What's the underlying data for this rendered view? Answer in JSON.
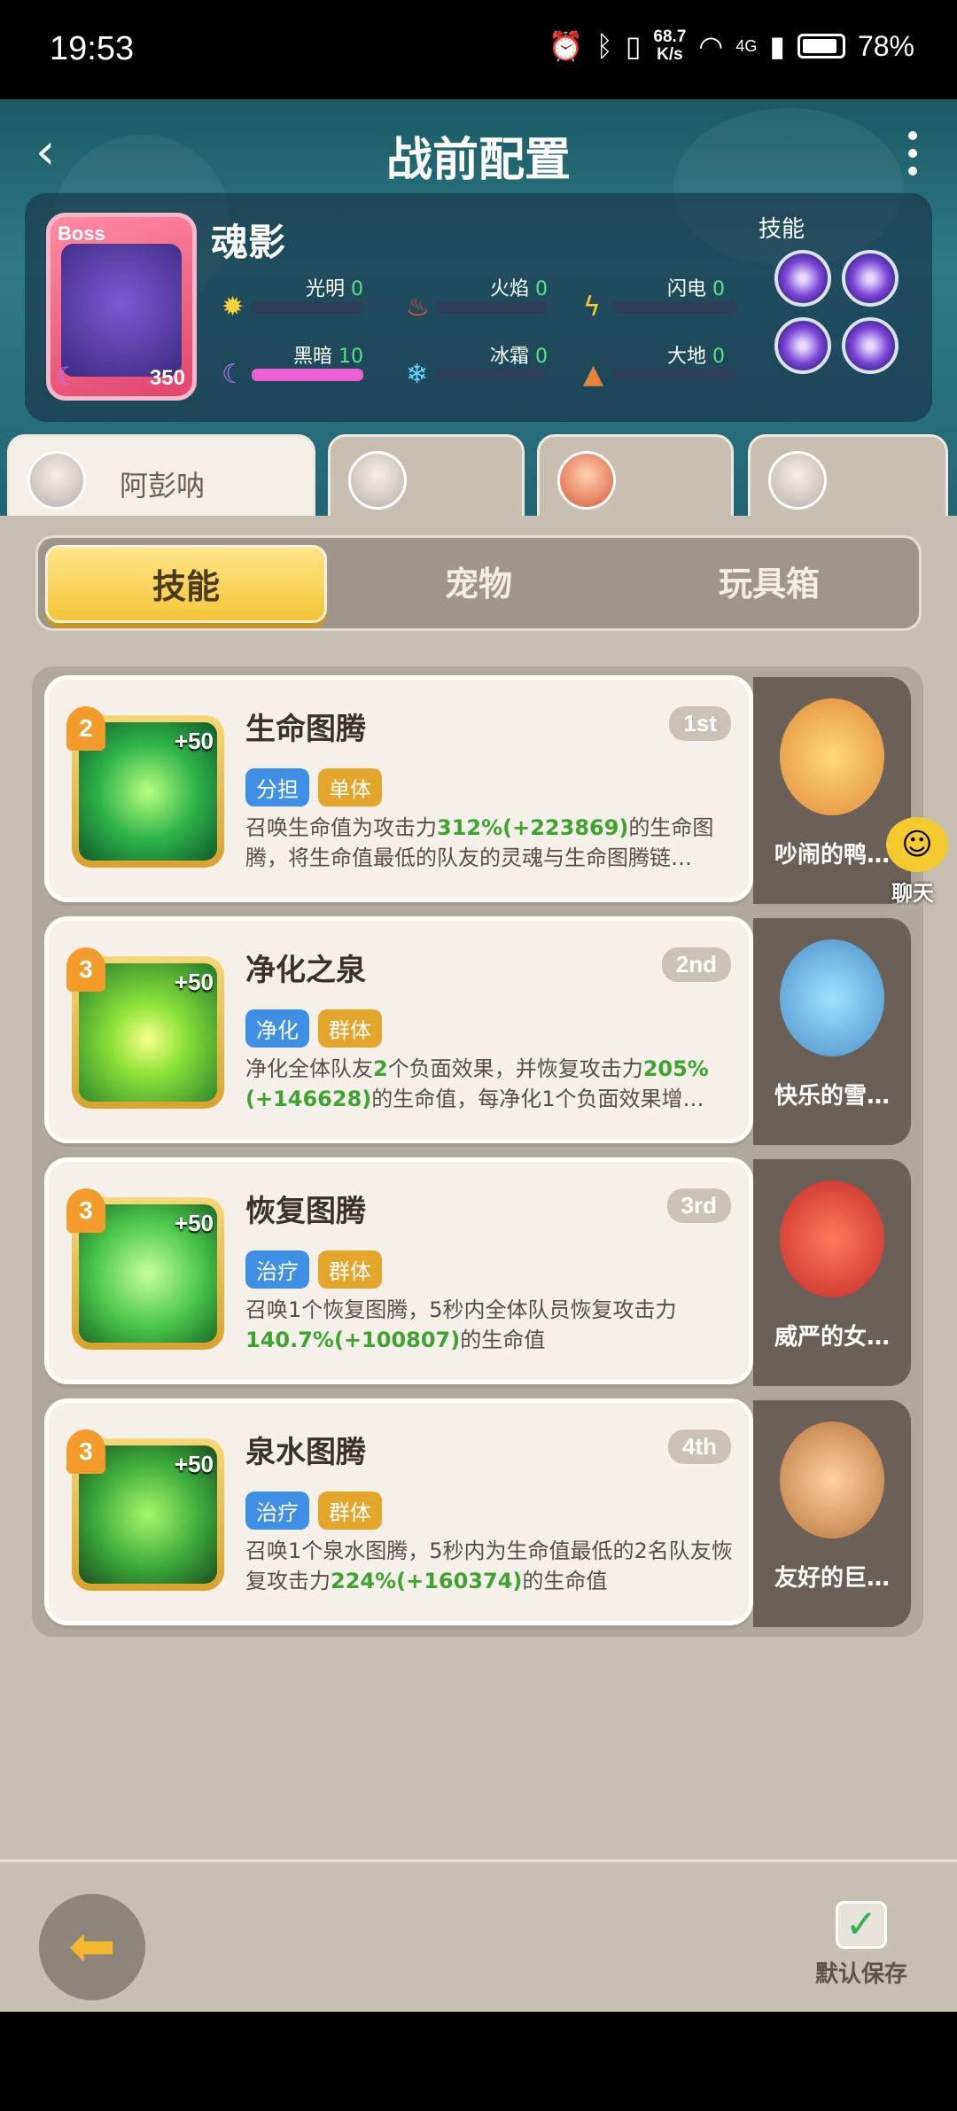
{
  "status": {
    "time": "19:53",
    "speed_top": "68.7",
    "speed_bottom": "K/s",
    "net": "4G",
    "battery": "78%"
  },
  "header": {
    "title": "战前配置"
  },
  "boss": {
    "badge": "Boss",
    "level": "350",
    "name": "魂影",
    "elements": [
      {
        "label": "光明",
        "value": "0",
        "icon": "sun-icon"
      },
      {
        "label": "火焰",
        "value": "0",
        "icon": "fire-icon"
      },
      {
        "label": "闪电",
        "value": "0",
        "icon": "lightning-icon"
      },
      {
        "label": "黑暗",
        "value": "10",
        "icon": "moon-icon"
      },
      {
        "label": "冰霜",
        "value": "0",
        "icon": "snowflake-icon"
      },
      {
        "label": "大地",
        "value": "0",
        "icon": "earth-icon"
      }
    ],
    "skills_label": "技能"
  },
  "heroes": [
    {
      "name": "阿彭呐"
    },
    {
      "name": ""
    },
    {
      "name": ""
    },
    {
      "name": ""
    }
  ],
  "tabs": [
    {
      "label": "技能"
    },
    {
      "label": "宠物"
    },
    {
      "label": "玩具箱"
    }
  ],
  "skills": [
    {
      "level": "2",
      "bonus": "+50",
      "name": "生命图腾",
      "rank": "1st",
      "tags": [
        "分担",
        "单体"
      ],
      "desc_a": "召唤生命值为攻击力",
      "hl1": "312%(+223869)",
      "desc_b": "的生命图腾，将生命值最低的队友的灵魂与生命图腾链…"
    },
    {
      "level": "3",
      "bonus": "+50",
      "name": "净化之泉",
      "rank": "2nd",
      "tags": [
        "净化",
        "群体"
      ],
      "desc_a": "净化全体队友",
      "hl1": "2",
      "desc_b": "个负面效果，并恢复攻击力",
      "hl2": "205%(+146628)",
      "desc_c": "的生命值，每净化1个负面效果增…"
    },
    {
      "level": "3",
      "bonus": "+50",
      "name": "恢复图腾",
      "rank": "3rd",
      "tags": [
        "治疗",
        "群体"
      ],
      "desc_a": "召唤1个恢复图腾，5秒内全体队员恢复攻击力",
      "hl1": "140.7%(+100807)",
      "desc_b": "的生命值"
    },
    {
      "level": "3",
      "bonus": "+50",
      "name": "泉水图腾",
      "rank": "4th",
      "tags": [
        "治疗",
        "群体"
      ],
      "desc_a": "召唤1个泉水图腾，5秒内为生命值最低的2名队友恢复攻击力",
      "hl1": "224%(+160374)",
      "desc_b": "的生命值"
    }
  ],
  "pets": [
    {
      "name": "吵闹的鸭…"
    },
    {
      "name": "快乐的雪…"
    },
    {
      "name": "威严的女…"
    },
    {
      "name": "友好的巨…"
    }
  ],
  "chat": {
    "label": "聊天"
  },
  "footer": {
    "save_label": "默认保存"
  }
}
